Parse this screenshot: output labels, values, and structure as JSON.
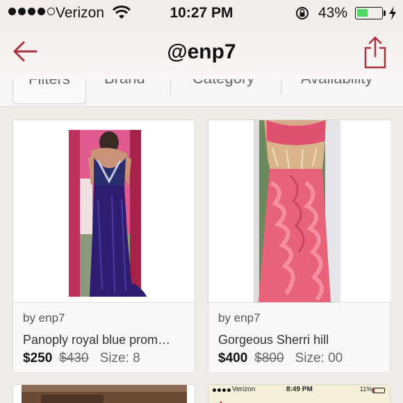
{
  "status_bar": {
    "carrier": "Verizon",
    "time": "10:27 PM",
    "battery_percent": "43%",
    "battery_level": 0.43
  },
  "nav": {
    "title": "@enp7",
    "back_icon": "back-arrow-icon",
    "share_icon": "share-icon"
  },
  "filters": {
    "items": [
      "Filters",
      "Brand",
      "Category",
      "Availability"
    ]
  },
  "listings": [
    {
      "by": "by enp7",
      "title": "Panoply royal blue prom…",
      "price": "$250",
      "original_price": "$430",
      "size": "Size: 8"
    },
    {
      "by": "by enp7",
      "title": "Gorgeous Sherri hill",
      "price": "$400",
      "original_price": "$800",
      "size": "Size: 00"
    }
  ],
  "bottom_preview": {
    "carrier": "Verizon",
    "time": "8:49 PM",
    "battery_percent": "11%"
  },
  "colors": {
    "accent": "#a8323e",
    "status_bg": "#f3eeee",
    "page_bg": "#efedea",
    "battery_green": "#4cd964"
  }
}
